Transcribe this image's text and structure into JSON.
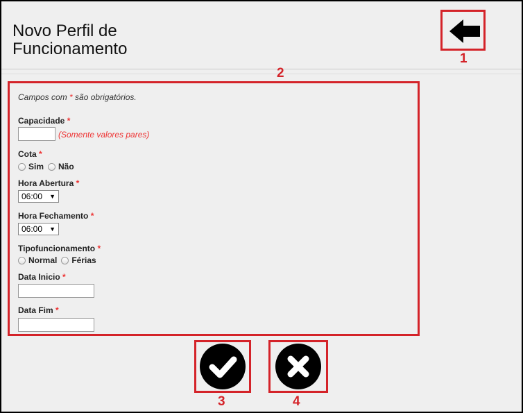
{
  "header": {
    "title": "Novo Perfil de Funcionamento"
  },
  "callouts": {
    "back": "1",
    "form": "2",
    "confirm": "3",
    "cancel": "4"
  },
  "form": {
    "required_note_prefix": "Campos com",
    "required_star": "*",
    "required_note_suffix": "são obrigatórios.",
    "fields": {
      "capacidade": {
        "label": "Capacidade",
        "value": "",
        "hint": "(Somente valores pares)"
      },
      "cota": {
        "label": "Cota",
        "options": [
          "Sim",
          "Não"
        ]
      },
      "hora_abertura": {
        "label": "Hora Abertura",
        "value": "06:00"
      },
      "hora_fechamento": {
        "label": "Hora Fechamento",
        "value": "06:00"
      },
      "tipo_funcionamento": {
        "label": "Tipofuncionamento",
        "options": [
          "Normal",
          "Férias"
        ]
      },
      "data_inicio": {
        "label": "Data Inicio",
        "value": ""
      },
      "data_fim": {
        "label": "Data Fim",
        "value": ""
      }
    }
  },
  "icons": {
    "back": "arrow-left-icon",
    "dropdown": "caret-down-icon",
    "confirm": "checkmark-icon",
    "cancel": "close-icon"
  },
  "colors": {
    "callout": "#d42329",
    "required": "#e33333",
    "background": "#efefef"
  }
}
